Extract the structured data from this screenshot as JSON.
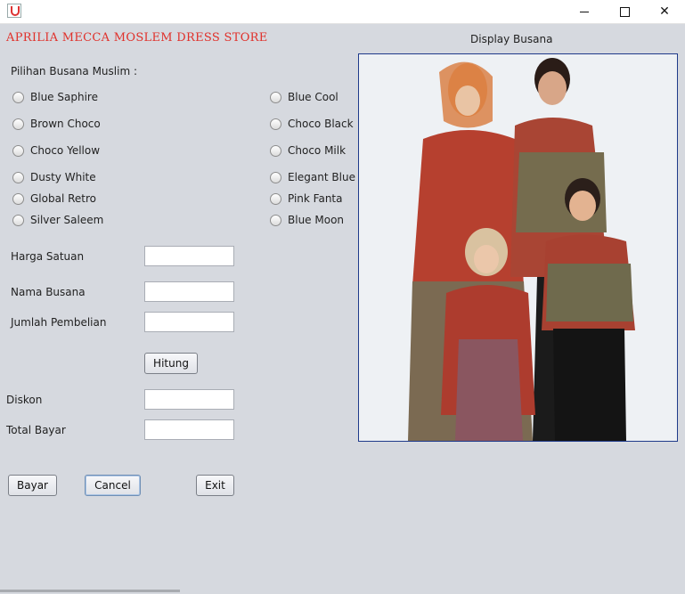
{
  "window": {
    "title": ""
  },
  "header": {
    "store_name": "APRILIA MECCA MOSLEM DRESS STORE",
    "display_label": "Display Busana"
  },
  "selection": {
    "heading": "Pilihan Busana Muslim :",
    "left_options": [
      "Blue Saphire",
      "Brown Choco",
      "Choco Yellow",
      "Dusty White",
      "Global Retro",
      "Silver Saleem"
    ],
    "right_options": [
      "Blue Cool",
      "Choco Black",
      "Choco Milk",
      "Elegant Blue",
      "Pink Fanta",
      "Blue Moon"
    ]
  },
  "form": {
    "harga_label": "Harga Satuan",
    "harga_value": "",
    "nama_label": "Nama Busana",
    "nama_value": "",
    "jumlah_label": "Jumlah Pembelian",
    "jumlah_value": "",
    "hitung_label": "Hitung",
    "diskon_label": "Diskon",
    "diskon_value": "",
    "total_label": "Total Bayar",
    "total_value": ""
  },
  "actions": {
    "bayar": "Bayar",
    "cancel": "Cancel",
    "exit": "Exit"
  },
  "icons": {
    "app": "java-app-icon",
    "minimize": "minimize-icon",
    "maximize": "maximize-icon",
    "close": "close-icon"
  },
  "colors": {
    "window_bg": "#d6d9df",
    "title_red": "#e0302a",
    "photo_border": "#1f3a8a"
  }
}
